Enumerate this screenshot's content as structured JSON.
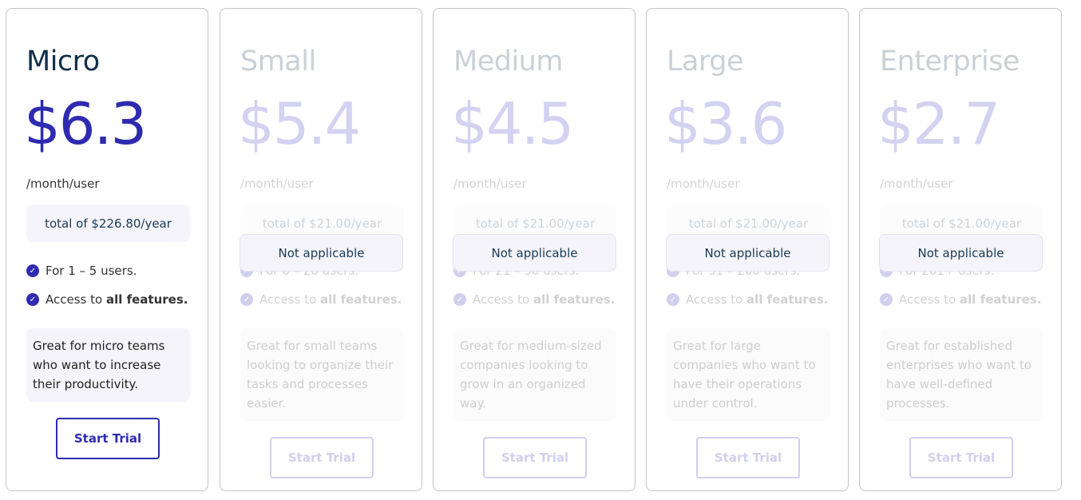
{
  "plans": [
    {
      "name": "Micro",
      "price": "$6.3",
      "period": "/month/user",
      "total": "total of $226.80/year",
      "users": "For 1 – 5 users.",
      "access_prefix": "Access to ",
      "access_bold": "all features.",
      "description": "Great for micro teams who want to increase their productivity.",
      "button": "Start Trial",
      "active": true
    },
    {
      "name": "Small",
      "price": "$5.4",
      "period": "/month/user",
      "total": "total of $21.00/year",
      "users": "For 6 – 20 users.",
      "access_prefix": "Access to ",
      "access_bold": "all features.",
      "description": "Great for small teams looking to organize their tasks and processes easier.",
      "button": "Start Trial",
      "overlay": "Not applicable",
      "active": false
    },
    {
      "name": "Medium",
      "price": "$4.5",
      "period": "/month/user",
      "total": "total of $21.00/year",
      "users": "For 21 – 50 users.",
      "access_prefix": "Access to ",
      "access_bold": "all features.",
      "description": "Great for medium-sized companies looking to grow in an organized way.",
      "button": "Start Trial",
      "overlay": "Not applicable",
      "active": false
    },
    {
      "name": "Large",
      "price": "$3.6",
      "period": "/month/user",
      "total": "total of $21.00/year",
      "users": "For 51 – 200 users.",
      "access_prefix": "Access to ",
      "access_bold": "all features.",
      "description": "Great for large companies who want to have their operations under control.",
      "button": "Start Trial",
      "overlay": "Not applicable",
      "active": false
    },
    {
      "name": "Enterprise",
      "price": "$2.7",
      "period": "/month/user",
      "total": "total of $21.00/year",
      "users": "For 201+ users.",
      "access_prefix": "Access to ",
      "access_bold": "all features.",
      "description": "Great for established enterprises who want to have well-defined processes.",
      "button": "Start Trial",
      "overlay": "Not applicable",
      "active": false
    }
  ],
  "colors": {
    "accent": "#2e2bb0",
    "title": "#0f2f4a",
    "box": "#f4f4fa"
  }
}
